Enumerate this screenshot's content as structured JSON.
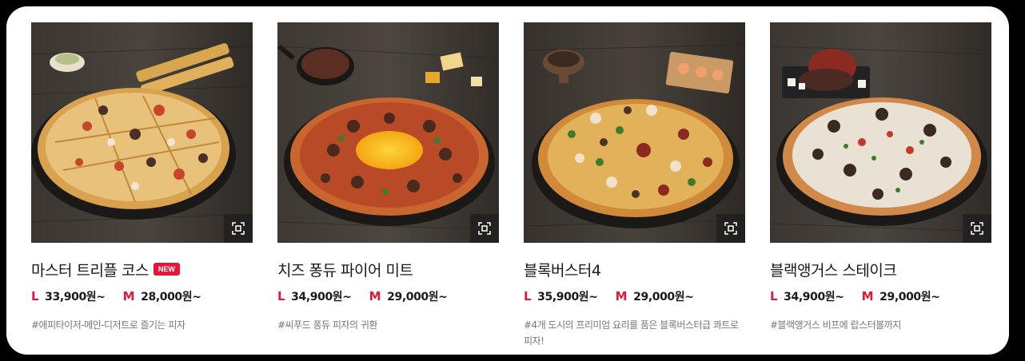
{
  "products": [
    {
      "name": "마스터 트리플 코스",
      "badge": "NEW",
      "size_l": "L",
      "price_l": "33,900원~",
      "size_m": "M",
      "price_m": "28,000원~",
      "description": "#애피타이저-메인-디저트로 즐기는 피자"
    },
    {
      "name": "치즈 퐁듀 파이어 미트",
      "badge": "",
      "size_l": "L",
      "price_l": "34,900원~",
      "size_m": "M",
      "price_m": "29,000원~",
      "description": "#씨푸드 퐁듀 피자의 귀환"
    },
    {
      "name": "블록버스터4",
      "badge": "",
      "size_l": "L",
      "price_l": "35,900원~",
      "size_m": "M",
      "price_m": "29,000원~",
      "description": "#4개 도시의 프리미엄 요리를 품은 블록버스터급 콰트로 피자!"
    },
    {
      "name": "블랙앵거스 스테이크",
      "badge": "",
      "size_l": "L",
      "price_l": "34,900원~",
      "size_m": "M",
      "price_m": "29,000원~",
      "description": "#블랙앵거스 비프에 랍스터볼까지"
    }
  ],
  "icons": {
    "zoom": "zoom-expand-icon"
  },
  "colors": {
    "accent": "#e4163a",
    "text": "#1a1a1a",
    "muted": "#777777"
  }
}
